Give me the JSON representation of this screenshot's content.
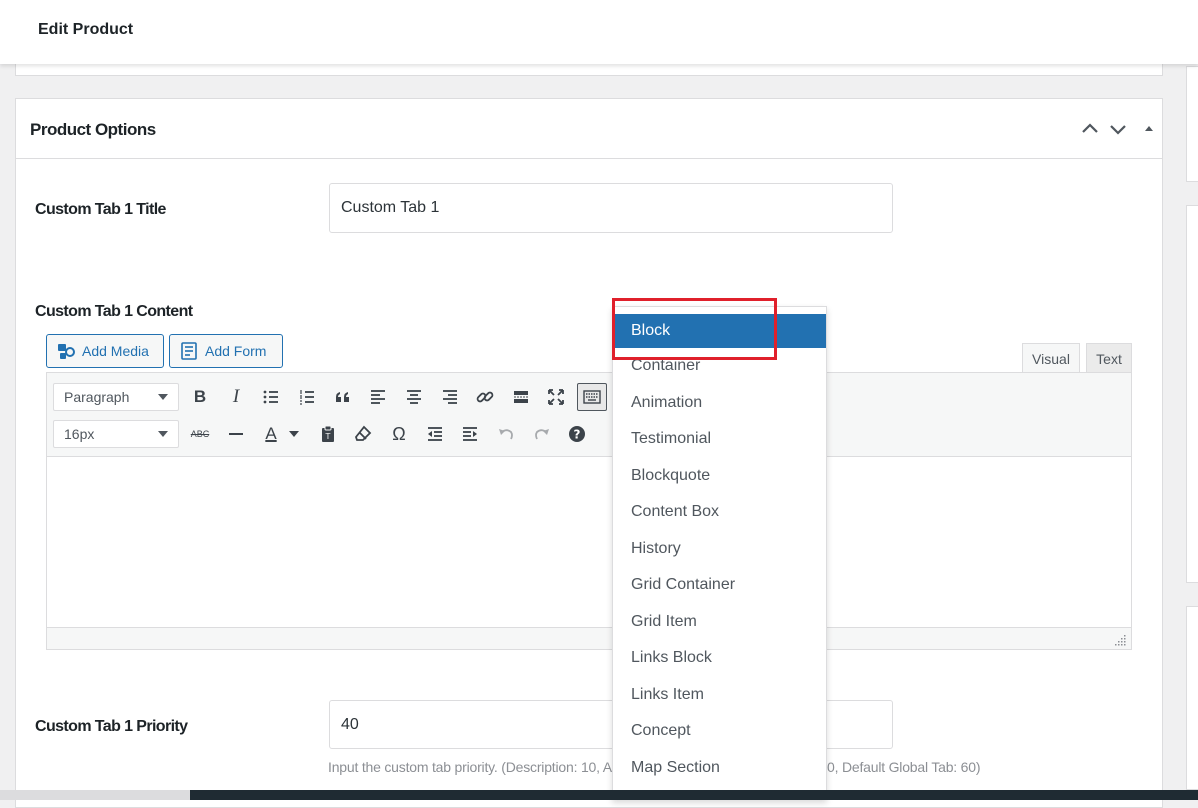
{
  "page": {
    "title": "Edit Product"
  },
  "panel": {
    "title": "Product Options",
    "controls": [
      "chevron-up-icon",
      "chevron-down-icon",
      "triangle-up-icon"
    ]
  },
  "fields": {
    "tab1_title": {
      "label": "Custom Tab 1 Title",
      "value": "Custom Tab 1"
    },
    "tab1_content": {
      "label": "Custom Tab 1 Content"
    },
    "tab1_priority": {
      "label": "Custom Tab 1 Priority",
      "value": "40",
      "description_left": "Input the custom tab priority. (Description: 10, A",
      "description_right": "0, Default Global Tab: 60)"
    }
  },
  "editor": {
    "add_media": "Add Media",
    "add_form": "Add Form",
    "tabs": {
      "visual": "Visual",
      "text": "Text",
      "active": "visual"
    },
    "format_select": "Paragraph",
    "size_select": "16px",
    "row1_icons": [
      "bold-icon",
      "italic-icon",
      "bullet-list-icon",
      "numbered-list-icon",
      "blockquote-icon",
      "align-left-icon",
      "align-center-icon",
      "align-right-icon",
      "link-icon",
      "read-more-icon",
      "fullscreen-icon",
      "toolbar-toggle-icon"
    ],
    "row2_icons": [
      "strikethrough-icon",
      "horizontal-line-icon",
      "text-color-icon",
      "paste-text-icon",
      "clear-formatting-icon",
      "special-character-icon",
      "outdent-icon",
      "indent-icon",
      "undo-icon",
      "redo-icon",
      "help-icon"
    ],
    "labels": {
      "bold": "B",
      "italic": "I",
      "strike": "ABC",
      "text_color": "A",
      "omega": "Ω",
      "help": "?"
    }
  },
  "dropdown": {
    "items": [
      "Block",
      "Container",
      "Animation",
      "Testimonial",
      "Blockquote",
      "Content Box",
      "History",
      "Grid Container",
      "Grid Item",
      "Links Block",
      "Links Item",
      "Concept",
      "Map Section"
    ],
    "selected": "Block"
  },
  "colors": {
    "accent": "#2271b1",
    "highlight_box": "#e0202b",
    "border": "#dcdcde",
    "background": "#f0f0f1"
  }
}
